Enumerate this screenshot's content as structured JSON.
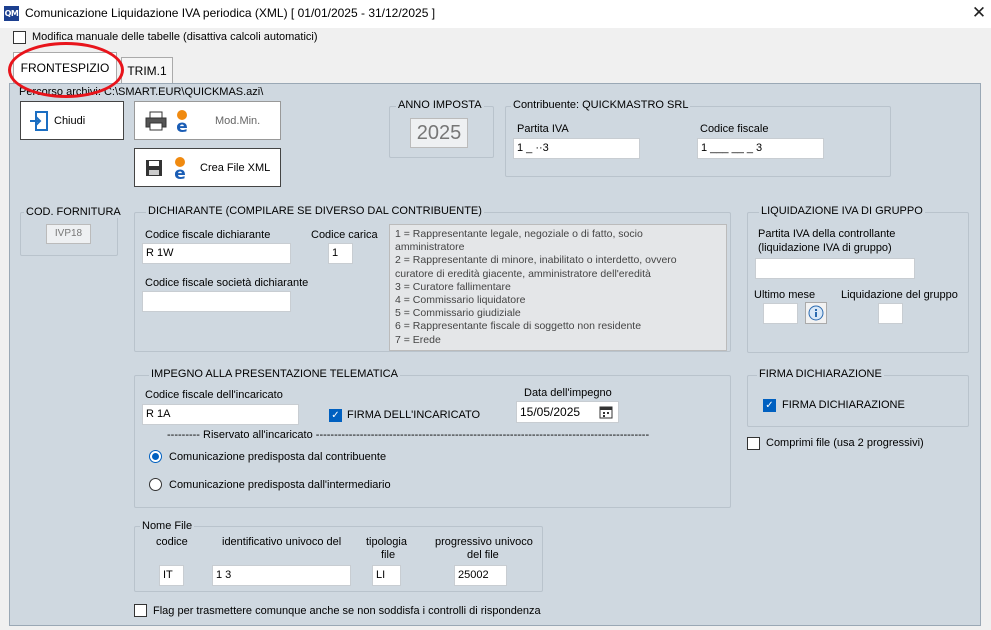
{
  "window": {
    "title": "Comunicazione Liquidazione IVA periodica (XML)   [ 01/01/2025 - 31/12/2025 ]",
    "app_icon_text": "QM",
    "close_glyph": "✕"
  },
  "manual_edit": {
    "label": "Modifica manuale delle tabelle (disattiva calcoli automatici)",
    "checked": false
  },
  "tabs": [
    {
      "label": "FRONTESPIZIO",
      "active": true
    },
    {
      "label": "TRIM.1",
      "active": false
    }
  ],
  "path_label": "Percorso archivi: C:\\SMART.EUR\\QUICKMAS.azi\\",
  "buttons": {
    "chiudi": "Chiudi",
    "modmin": "Mod.Min.",
    "crea_xml": "Crea File XML"
  },
  "anno_imposta": {
    "label": "ANNO IMPOSTA",
    "value": "2025"
  },
  "contribuente": {
    "label": "Contribuente: QUICKMASTRO SRL",
    "piva_label": "Partita IVA",
    "piva_value": "1 _     ··3",
    "cf_label": "Codice fiscale",
    "cf_value": "1 ___ __  _ 3"
  },
  "fornitura": {
    "label": "COD. FORNITURA",
    "value": "IVP18"
  },
  "dichiarante": {
    "label": "DICHIARANTE (COMPILARE SE DIVERSO DAL CONTRIBUENTE)",
    "cf_label": "Codice fiscale dichiarante",
    "cf_value": "R          1W",
    "carica_label": "Codice carica",
    "carica_value": "1",
    "cf_soc_label": "Codice fiscale società dichiarante",
    "cf_soc_value": "",
    "carica_options": [
      "1 = Rappresentante legale, negoziale o di fatto, socio",
      "amministratore",
      "2 = Rappresentante di minore, inabilitato o interdetto, ovvero",
      "curatore di eredità giacente, amministratore dell'eredità",
      "3 = Curatore fallimentare",
      "4 = Commissario liquidatore",
      "5 = Commissario giudiziale",
      "6 = Rappresentante fiscale di soggetto non residente",
      "7 = Erede"
    ]
  },
  "gruppo": {
    "label": "LIQUIDAZIONE IVA DI GRUPPO",
    "piva_label_1": "Partita IVA della controllante",
    "piva_label_2": "(liquidazione IVA di gruppo)",
    "piva_value": "",
    "ultimo_mese_label": "Ultimo mese",
    "ultimo_mese_value": "",
    "liq_gruppo_label": "Liquidazione del gruppo",
    "liq_gruppo_value": ""
  },
  "impegno": {
    "label": "IMPEGNO ALLA PRESENTAZIONE TELEMATICA",
    "cf_label": "Codice fiscale dell'incaricato",
    "cf_value": "R        1A",
    "firma_incaricato_label": "FIRMA DELL'INCARICATO",
    "firma_incaricato_checked": true,
    "data_label": "Data dell'impegno",
    "data_value": "15/05/2025",
    "riservato_label": "--------- Riservato all'incaricato -------------------------------------------------------------------------------------------",
    "radio_contribuente": "Comunicazione predisposta dal contribuente",
    "radio_intermediario": "Comunicazione predisposta dall'intermediario",
    "selected": "contribuente"
  },
  "firma": {
    "label": "FIRMA DICHIARAZIONE",
    "checkbox_label": "FIRMA DICHIARAZIONE",
    "checked": true
  },
  "comprimi": {
    "label": "Comprimi file (usa 2 progressivi)",
    "checked": false
  },
  "nome_file": {
    "label": "Nome File",
    "codice_label": "codice",
    "codice_value": "IT",
    "id_label": "identificativo univoco del",
    "id_value": "1        3",
    "tipologia_label_1": "tipologia",
    "tipologia_label_2": "file",
    "tipologia_value": "LI",
    "progressivo_label_1": "progressivo univoco",
    "progressivo_label_2": "del file",
    "progressivo_value": "25002"
  },
  "flag_trasmettere": {
    "label": "Flag per trasmettere comunque anche se non soddisfa i controlli di rispondenza",
    "checked": false
  },
  "colors": {
    "panel": "#cfd8e0",
    "accent": "#0060c0",
    "highlight": "#e8141b"
  }
}
